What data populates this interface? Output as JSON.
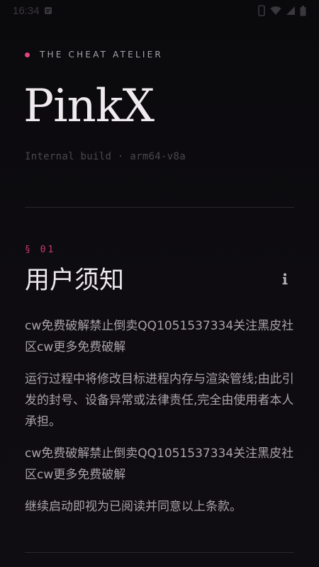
{
  "statusbar": {
    "time": "16:34"
  },
  "header": {
    "brand": "THE CHEAT ATELIER",
    "title": "PinkX",
    "build_info": "Internal build · arm64-v8a",
    "accent_color": "#e2417f"
  },
  "section": {
    "number": "§ 01",
    "title": "用户须知",
    "info_icon": "info-icon"
  },
  "notice": {
    "paragraphs": [
      "cw免费破解禁止倒卖QQ1051537334关注黑皮社区cw更多免费破解",
      "运行过程中将修改目标进程内存与渲染管线;由此引发的封号、设备异常或法律责任,完全由使用者本人承担。",
      "cw免费破解禁止倒卖QQ1051537334关注黑皮社区cw更多免费破解",
      "继续启动即视为已阅读并同意以上条款。"
    ]
  }
}
